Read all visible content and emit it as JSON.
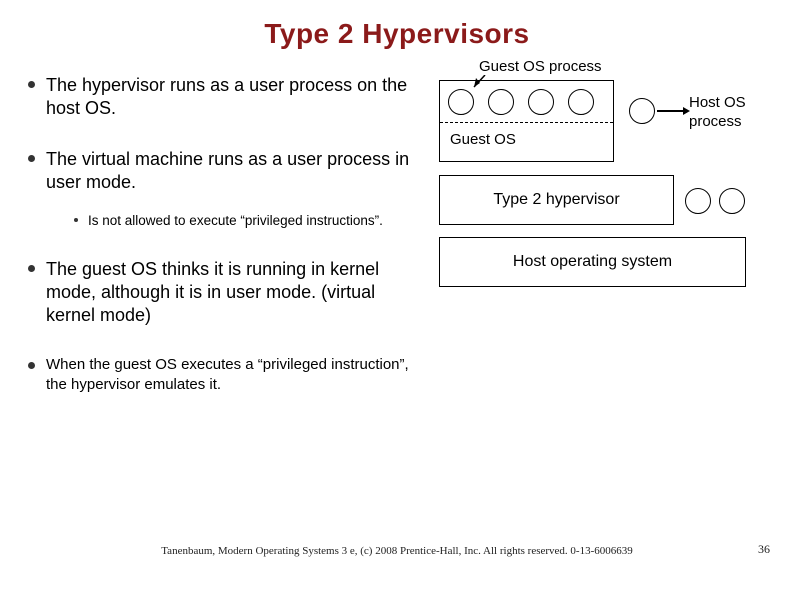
{
  "title": "Type 2 Hypervisors",
  "bullets": {
    "b1": "The hypervisor runs as a user process on the host OS.",
    "b2": "The virtual machine runs as a user process in user mode.",
    "b2_sub1": "Is not allowed to execute “privileged instructions”.",
    "b3": "The guest OS thinks it is running in kernel mode, although it is in user mode. (virtual kernel mode)",
    "b4": "When the guest OS executes a “privileged instruction”, the hypervisor emulates it."
  },
  "diagram": {
    "guest_os_process": "Guest OS process",
    "host_os_process": "Host OS\nprocess",
    "guest_os": "Guest OS",
    "type2_hypervisor": "Type 2 hypervisor",
    "host_operating_system": "Host operating system"
  },
  "footer": "Tanenbaum, Modern Operating Systems 3 e, (c) 2008 Prentice-Hall, Inc. All rights reserved. 0-13-6006639",
  "pagenum": "36"
}
